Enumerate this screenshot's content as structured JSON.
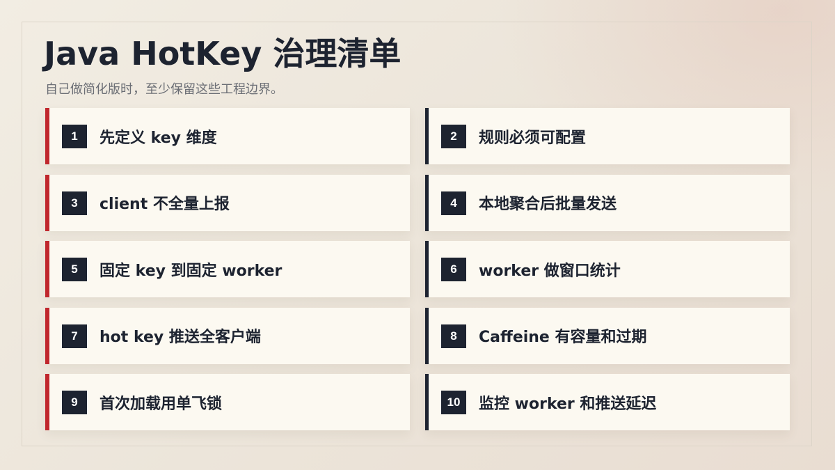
{
  "title": "Java HotKey 治理清单",
  "subtitle": "自己做简化版时，至少保留这些工程边界。",
  "accent_color": "#c0272d",
  "dark_color": "#1d2330",
  "items": [
    {
      "num": "1",
      "label": "先定义 key 维度"
    },
    {
      "num": "2",
      "label": "规则必须可配置"
    },
    {
      "num": "3",
      "label": "client 不全量上报"
    },
    {
      "num": "4",
      "label": "本地聚合后批量发送"
    },
    {
      "num": "5",
      "label": "固定 key 到固定 worker"
    },
    {
      "num": "6",
      "label": "worker 做窗口统计"
    },
    {
      "num": "7",
      "label": "hot key 推送全客户端"
    },
    {
      "num": "8",
      "label": "Caffeine 有容量和过期"
    },
    {
      "num": "9",
      "label": "首次加载用单飞锁"
    },
    {
      "num": "10",
      "label": "监控 worker 和推送延迟"
    }
  ]
}
